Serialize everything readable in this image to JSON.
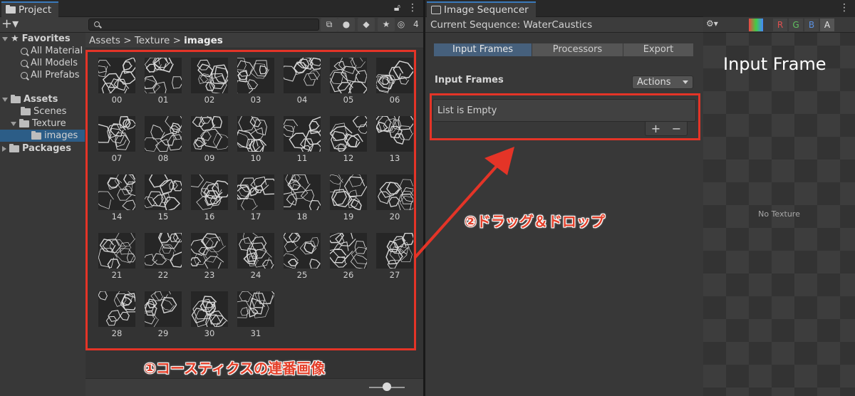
{
  "project": {
    "tab_title": "Project",
    "hidden_count": "4",
    "tree": [
      {
        "label": "Favorites",
        "type": "header",
        "icon": "star-icon"
      },
      {
        "label": "All Material",
        "type": "search"
      },
      {
        "label": "All Models",
        "type": "search"
      },
      {
        "label": "All Prefabs",
        "type": "search"
      },
      {
        "label": "Assets",
        "type": "header-folder"
      },
      {
        "label": "Scenes",
        "type": "folder"
      },
      {
        "label": "Texture",
        "type": "folder-open"
      },
      {
        "label": "images",
        "type": "folder-selected"
      },
      {
        "label": "Packages",
        "type": "header-folder-collapsed"
      }
    ],
    "breadcrumb": {
      "part1": "Assets",
      "part2": "Texture",
      "current": "images",
      "sep": ">"
    },
    "assets": [
      "00",
      "01",
      "02",
      "03",
      "04",
      "05",
      "06",
      "07",
      "08",
      "09",
      "10",
      "11",
      "12",
      "13",
      "14",
      "15",
      "16",
      "17",
      "18",
      "19",
      "20",
      "21",
      "22",
      "23",
      "24",
      "25",
      "26",
      "27",
      "28",
      "29",
      "30",
      "31"
    ]
  },
  "sequencer": {
    "tab_title": "Image Sequencer",
    "current_sequence": "Current Sequence: WaterCaustics",
    "tabs": [
      "Input Frames",
      "Processors",
      "Export"
    ],
    "section_title": "Input Frames",
    "actions_label": "Actions",
    "list_empty": "List is Empty",
    "add": "+",
    "remove": "−"
  },
  "preview": {
    "title": "Input Frame",
    "channels": [
      "R",
      "G",
      "B",
      "A"
    ],
    "empty": "No Texture"
  },
  "annotations": {
    "one": "①コースティクスの連番画像",
    "two": "②ドラッグ＆ドロップ"
  },
  "colors": {
    "accent": "#e43427",
    "selection": "#2c5d87",
    "active_tab": "#46607c"
  }
}
